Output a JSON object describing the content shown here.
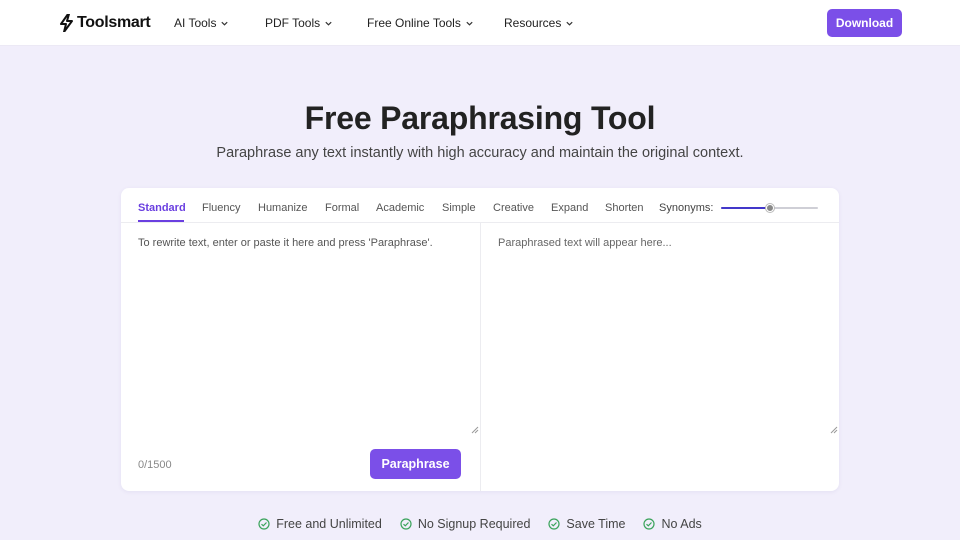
{
  "header": {
    "logo_text": "Toolsmart",
    "nav": [
      {
        "label": "AI Tools"
      },
      {
        "label": "PDF Tools"
      },
      {
        "label": "Free Online Tools"
      },
      {
        "label": "Resources"
      }
    ],
    "download_label": "Download"
  },
  "hero": {
    "title": "Free Paraphrasing Tool",
    "subtitle": "Paraphrase any text instantly with high accuracy and maintain the original context."
  },
  "tool": {
    "modes": [
      {
        "label": "Standard",
        "active": true
      },
      {
        "label": "Fluency"
      },
      {
        "label": "Humanize"
      },
      {
        "label": "Formal"
      },
      {
        "label": "Academic"
      },
      {
        "label": "Simple"
      },
      {
        "label": "Creative"
      },
      {
        "label": "Expand"
      },
      {
        "label": "Shorten"
      }
    ],
    "synonyms_label": "Synonyms:",
    "synonyms_level": 0.5,
    "input_placeholder": "To rewrite text, enter or paste it here and press 'Paraphrase'.",
    "output_placeholder": "Paraphrased text will appear here...",
    "char_count": "0/1500",
    "paraphrase_label": "Paraphrase"
  },
  "features": [
    {
      "label": "Free and Unlimited"
    },
    {
      "label": "No Signup Required"
    },
    {
      "label": "Save Time"
    },
    {
      "label": "No Ads"
    }
  ],
  "colors": {
    "accent": "#7b4fe8",
    "active_tab": "#6a3fe0",
    "page_bg": "#f1eefb",
    "check": "#3aa35b"
  }
}
